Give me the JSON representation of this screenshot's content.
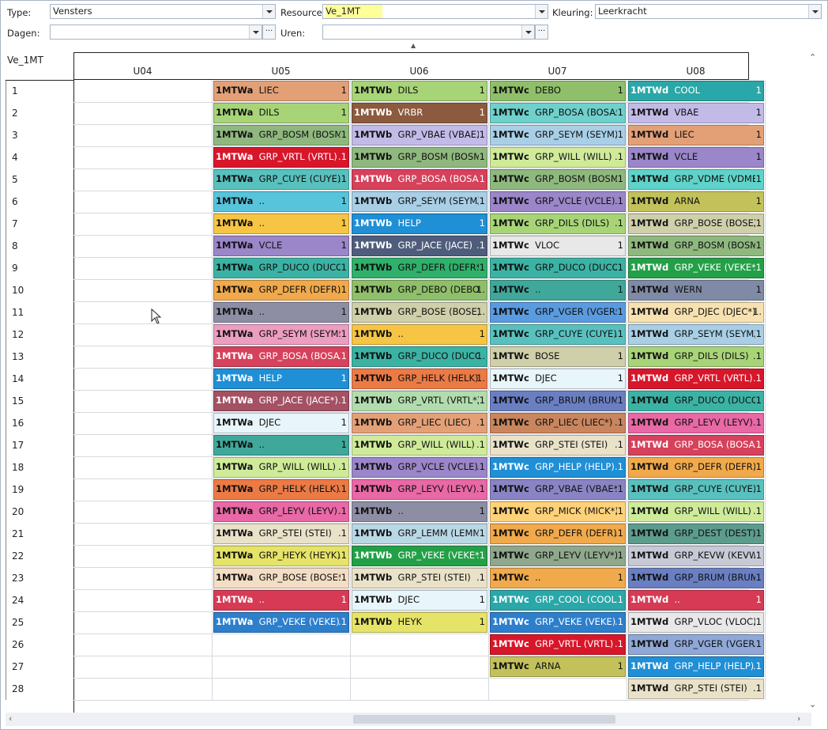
{
  "toolbar": {
    "type_label": "Type:",
    "type_value": "Vensters",
    "resource_label": "Resource:",
    "resource_value": "Ve_1MT",
    "kleuring_label": "Kleuring:",
    "kleuring_value": "Leerkracht",
    "dagen_label": "Dagen:",
    "dagen_value": "",
    "uren_label": "Uren:",
    "uren_value": "",
    "more_label": "···"
  },
  "grid": {
    "resource_title": "Ve_1MT",
    "columns": [
      "U04",
      "U05",
      "U06",
      "U07",
      "U08"
    ],
    "rows": [
      "1",
      "2",
      "3",
      "4",
      "5",
      "6",
      "7",
      "8",
      "9",
      "10",
      "11",
      "12",
      "13",
      "14",
      "15",
      "16",
      "17",
      "18",
      "19",
      "20",
      "21",
      "22",
      "23",
      "24",
      "25",
      "26",
      "27",
      "28"
    ],
    "cells": [
      [
        {
          "c": "1MTWa",
          "t": "LIEC",
          "n": "1",
          "bg": "#e3a077",
          "fg": "#111"
        },
        {
          "c": "1MTWa",
          "t": "DILS",
          "n": "1",
          "bg": "#a8d478",
          "fg": "#111"
        },
        {
          "c": "1MTWa",
          "t": "GRP_BOSM (BOSM)",
          "n": ".1",
          "bg": "#8fb87e",
          "fg": "#111"
        },
        {
          "c": "1MTWa",
          "t": "GRP_VRTL (VRTL)",
          "n": ".1",
          "bg": "#d8162a",
          "fg": "#fff"
        },
        {
          "c": "1MTWa",
          "t": "GRP_CUYE (CUYE)",
          "n": ".1",
          "bg": "#58c1be",
          "fg": "#111"
        },
        {
          "c": "1MTWa",
          "t": "..",
          "n": "1",
          "bg": "#57c4dc",
          "fg": "#111"
        },
        {
          "c": "1MTWa",
          "t": "..",
          "n": "1",
          "bg": "#f7c544",
          "fg": "#111"
        },
        {
          "c": "1MTWa",
          "t": "VCLE",
          "n": "1",
          "bg": "#9a86c8",
          "fg": "#111"
        },
        {
          "c": "1MTWa",
          "t": "GRP_DUCO (DUCO)",
          "n": ".1",
          "bg": "#3bb3a4",
          "fg": "#111"
        },
        {
          "c": "1MTWa",
          "t": "GRP_DEFR (DEFR)",
          "n": ".1",
          "bg": "#f0a94b",
          "fg": "#111"
        },
        {
          "c": "1MTWa",
          "t": "..",
          "n": "1",
          "bg": "#8d8ea4",
          "fg": "#111"
        },
        {
          "c": "1MTWa",
          "t": "GRP_SEYM (SEYM*)",
          "n": ".1",
          "bg": "#ec9dc0",
          "fg": "#111"
        },
        {
          "c": "1MTWa",
          "t": "GRP_BOSA (BOSA)",
          "n": ".1",
          "bg": "#d6415b",
          "fg": "#fff"
        },
        {
          "c": "1MTWa",
          "t": "HELP",
          "n": "1",
          "bg": "#1f8fd6",
          "fg": "#fff"
        },
        {
          "c": "1MTWa",
          "t": "GRP_JACE (JACE*)",
          "n": ".1",
          "bg": "#a35163",
          "fg": "#fff"
        },
        {
          "c": "1MTWa",
          "t": "DJEC",
          "n": "1",
          "bg": "#e8f6fb",
          "fg": "#111"
        },
        {
          "c": "1MTWa",
          "t": "..",
          "n": "1",
          "bg": "#3fa89b",
          "fg": "#111"
        },
        {
          "c": "1MTWa",
          "t": "GRP_WILL (WILL)",
          "n": ".1",
          "bg": "#cfeb9a",
          "fg": "#111"
        },
        {
          "c": "1MTWa",
          "t": "GRP_HELK (HELK)",
          "n": ".1",
          "bg": "#ec7a45",
          "fg": "#111"
        },
        {
          "c": "1MTWa",
          "t": "GRP_LEYV (LEYV)",
          "n": ".1",
          "bg": "#e968a6",
          "fg": "#111"
        },
        {
          "c": "1MTWa",
          "t": "GRP_STEI (STEI)",
          "n": ".1",
          "bg": "#e9e2c9",
          "fg": "#111"
        },
        {
          "c": "1MTWa",
          "t": "GRP_HEYK (HEYK)",
          "n": ".1",
          "bg": "#e6e468",
          "fg": "#111"
        },
        {
          "c": "1MTWa",
          "t": "GRP_BOSE (BOSE*)",
          "n": ".1",
          "bg": "#f3ddc4",
          "fg": "#111"
        },
        {
          "c": "1MTWa",
          "t": "..",
          "n": "1",
          "bg": "#d63a54",
          "fg": "#fff"
        },
        {
          "c": "1MTWa",
          "t": "GRP_VEKE (VEKE)",
          "n": ".1",
          "bg": "#2d7fcc",
          "fg": "#fff"
        },
        null,
        null,
        null
      ],
      [
        {
          "c": "1MTWb",
          "t": "DILS",
          "n": "1",
          "bg": "#a8d478",
          "fg": "#111"
        },
        {
          "c": "1MTWb",
          "t": "VRBR",
          "n": "1",
          "bg": "#8c5a3e",
          "fg": "#fff"
        },
        {
          "c": "1MTWb",
          "t": "GRP_VBAE (VBAE)",
          "n": ".1",
          "bg": "#c2bbe8",
          "fg": "#111"
        },
        {
          "c": "1MTWb",
          "t": "GRP_BOSM (BOSM)",
          "n": ".1",
          "bg": "#8fb87e",
          "fg": "#111"
        },
        {
          "c": "1MTWb",
          "t": "GRP_BOSA (BOSA)",
          "n": ".1",
          "bg": "#d6415b",
          "fg": "#fff"
        },
        {
          "c": "1MTWb",
          "t": "GRP_SEYM (SEYM)",
          "n": ".1",
          "bg": "#a8cfe6",
          "fg": "#111"
        },
        {
          "c": "1MTWb",
          "t": "HELP",
          "n": "1",
          "bg": "#1f8fd6",
          "fg": "#fff"
        },
        {
          "c": "1MTWb",
          "t": "GRP_JACE (JACE)",
          "n": ".1",
          "bg": "#4f5d7c",
          "fg": "#fff"
        },
        {
          "c": "1MTWb",
          "t": "GRP_DEFR (DEFR*)",
          "n": ".1",
          "bg": "#2fb06b",
          "fg": "#111"
        },
        {
          "c": "1MTWb",
          "t": "GRP_DEBO (DEBO)",
          "n": "1.",
          "bg": "#8fbf6a",
          "fg": "#111"
        },
        {
          "c": "1MTWb",
          "t": "GRP_BOSE (BOSE)",
          "n": "1.",
          "bg": "#cfcfaa",
          "fg": "#111"
        },
        {
          "c": "1MTWb",
          "t": "..",
          "n": "1",
          "bg": "#f7c544",
          "fg": "#111"
        },
        {
          "c": "1MTWb",
          "t": "GRP_DUCO (DUCO)",
          "n": "1.",
          "bg": "#3bb3a4",
          "fg": "#111"
        },
        {
          "c": "1MTWb",
          "t": "GRP_HELK (HELK)",
          "n": "1.",
          "bg": "#ec7a45",
          "fg": "#111"
        },
        {
          "c": "1MTWb",
          "t": "GRP_VRTL (VRTL*)",
          "n": ".1",
          "bg": "#b2dcae",
          "fg": "#111"
        },
        {
          "c": "1MTWb",
          "t": "GRP_LIEC (LIEC)",
          "n": ".1",
          "bg": "#e3a077",
          "fg": "#111"
        },
        {
          "c": "1MTWb",
          "t": "GRP_WILL (WILL)",
          "n": ".1",
          "bg": "#cfeb9a",
          "fg": "#111"
        },
        {
          "c": "1MTWb",
          "t": "GRP_VCLE (VCLE)",
          "n": ".1",
          "bg": "#9a86c8",
          "fg": "#111"
        },
        {
          "c": "1MTWb",
          "t": "GRP_LEYV (LEYV)",
          "n": ".1",
          "bg": "#e968a6",
          "fg": "#111"
        },
        {
          "c": "1MTWb",
          "t": "..",
          "n": "1",
          "bg": "#8d8ea4",
          "fg": "#111"
        },
        {
          "c": "1MTWb",
          "t": "GRP_LEMM (LEMM)",
          "n": ".1",
          "bg": "#b9d8e6",
          "fg": "#111"
        },
        {
          "c": "1MTWb",
          "t": "GRP_VEKE (VEKE*)",
          "n": ".1",
          "bg": "#23a047",
          "fg": "#fff"
        },
        {
          "c": "1MTWb",
          "t": "GRP_STEI (STEI)",
          "n": ".1",
          "bg": "#e9e2c9",
          "fg": "#111"
        },
        {
          "c": "1MTWb",
          "t": "DJEC",
          "n": "1",
          "bg": "#e8f6fb",
          "fg": "#111"
        },
        {
          "c": "1MTWb",
          "t": "HEYK",
          "n": "1",
          "bg": "#e6e468",
          "fg": "#111"
        },
        null,
        null,
        null
      ],
      [
        {
          "c": "1MTWc",
          "t": "DEBO",
          "n": "1",
          "bg": "#8fbf6a",
          "fg": "#111"
        },
        {
          "c": "1MTWc",
          "t": "GRP_BOSA (BOSA*)",
          "n": ".1",
          "bg": "#6fd0cc",
          "fg": "#111"
        },
        {
          "c": "1MTWc",
          "t": "GRP_SEYM (SEYM)",
          "n": ".1",
          "bg": "#a8cfe6",
          "fg": "#111"
        },
        {
          "c": "1MTWc",
          "t": "GRP_WILL (WILL)",
          "n": ".1",
          "bg": "#cfeb9a",
          "fg": "#111"
        },
        {
          "c": "1MTWc",
          "t": "GRP_BOSM (BOSM)",
          "n": ".1",
          "bg": "#8fb87e",
          "fg": "#111"
        },
        {
          "c": "1MTWc",
          "t": "GRP_VCLE (VCLE)",
          "n": ".1",
          "bg": "#9a86c8",
          "fg": "#111"
        },
        {
          "c": "1MTWc",
          "t": "GRP_DILS (DILS)",
          "n": ".1",
          "bg": "#a8d478",
          "fg": "#111"
        },
        {
          "c": "1MTWc",
          "t": "VLOC",
          "n": "1",
          "bg": "#e8e8e8",
          "fg": "#111"
        },
        {
          "c": "1MTWc",
          "t": "GRP_DUCO (DUCO)",
          "n": ".1",
          "bg": "#3bb3a4",
          "fg": "#111"
        },
        {
          "c": "1MTWc",
          "t": "..",
          "n": "1",
          "bg": "#3fa89b",
          "fg": "#111"
        },
        {
          "c": "1MTWc",
          "t": "GRP_VGER (VGER*)",
          "n": ".1",
          "bg": "#5a9be0",
          "fg": "#111"
        },
        {
          "c": "1MTWc",
          "t": "GRP_CUYE (CUYE)",
          "n": ".1",
          "bg": "#58c1be",
          "fg": "#111"
        },
        {
          "c": "1MTWc",
          "t": "BOSE",
          "n": "1",
          "bg": "#cfcfaa",
          "fg": "#111"
        },
        {
          "c": "1MTWc",
          "t": "DJEC",
          "n": "1",
          "bg": "#e8f6fb",
          "fg": "#111"
        },
        {
          "c": "1MTWc",
          "t": "GRP_BRUM (BRUM)",
          "n": ".1",
          "bg": "#6a7fc2",
          "fg": "#111"
        },
        {
          "c": "1MTWc",
          "t": "GRP_LIEC (LIEC*)",
          "n": ".1",
          "bg": "#c9855e",
          "fg": "#111"
        },
        {
          "c": "1MTWc",
          "t": "GRP_STEI (STEI)",
          "n": ".1",
          "bg": "#e9e2c9",
          "fg": "#111"
        },
        {
          "c": "1MTWc",
          "t": "GRP_HELP (HELP)",
          "n": ".1",
          "bg": "#1f8fd6",
          "fg": "#fff"
        },
        {
          "c": "1MTWc",
          "t": "GRP_VBAE (VBAE*)",
          "n": ".1",
          "bg": "#8a84c4",
          "fg": "#111"
        },
        {
          "c": "1MTWc",
          "t": "GRP_MICK (MICK*)",
          "n": ".1",
          "bg": "#ffd27a",
          "fg": "#111"
        },
        {
          "c": "1MTWc",
          "t": "GRP_DEFR (DEFR)",
          "n": ".1",
          "bg": "#f0a94b",
          "fg": "#111"
        },
        {
          "c": "1MTWc",
          "t": "GRP_LEYV (LEYV*)",
          "n": ".1",
          "bg": "#8fa88c",
          "fg": "#111"
        },
        {
          "c": "1MTWc",
          "t": "..",
          "n": "1",
          "bg": "#f0a94b",
          "fg": "#111"
        },
        {
          "c": "1MTWc",
          "t": "GRP_COOL (COOL)",
          "n": ".1",
          "bg": "#2aa7a8",
          "fg": "#fff"
        },
        {
          "c": "1MTWc",
          "t": "GRP_VEKE (VEKE)",
          "n": ".1",
          "bg": "#2d7fcc",
          "fg": "#fff"
        },
        {
          "c": "1MTWc",
          "t": "GRP_VRTL (VRTL)",
          "n": ".1",
          "bg": "#d8162a",
          "fg": "#fff"
        },
        {
          "c": "1MTWc",
          "t": "ARNA",
          "n": "1",
          "bg": "#c3c25a",
          "fg": "#111"
        },
        null
      ],
      [
        {
          "c": "1MTWd",
          "t": "COOL",
          "n": "1",
          "bg": "#2aa7a8",
          "fg": "#fff"
        },
        {
          "c": "1MTWd",
          "t": "VBAE",
          "n": "1",
          "bg": "#c2bbe8",
          "fg": "#111"
        },
        {
          "c": "1MTWd",
          "t": "LIEC",
          "n": "1",
          "bg": "#e3a077",
          "fg": "#111"
        },
        {
          "c": "1MTWd",
          "t": "VCLE",
          "n": "1",
          "bg": "#9a86c8",
          "fg": "#111"
        },
        {
          "c": "1MTWd",
          "t": "GRP_VDME (VDME)",
          "n": ".1",
          "bg": "#5fd3c9",
          "fg": "#111"
        },
        {
          "c": "1MTWd",
          "t": "ARNA",
          "n": "1",
          "bg": "#c3c25a",
          "fg": "#111"
        },
        {
          "c": "1MTWd",
          "t": "GRP_BOSE (BOSE)",
          "n": ".1",
          "bg": "#cfcfaa",
          "fg": "#111"
        },
        {
          "c": "1MTWd",
          "t": "GRP_BOSM (BOSM)",
          "n": ".1",
          "bg": "#8fb87e",
          "fg": "#111"
        },
        {
          "c": "1MTWd",
          "t": "GRP_VEKE (VEKE*)",
          "n": ".1",
          "bg": "#23a047",
          "fg": "#fff"
        },
        {
          "c": "1MTWd",
          "t": "WERN",
          "n": "1",
          "bg": "#7f8aa6",
          "fg": "#111"
        },
        {
          "c": "1MTWd",
          "t": "GRP_DJEC (DJEC*)",
          "n": "1.",
          "bg": "#f7e1b0",
          "fg": "#111"
        },
        {
          "c": "1MTWd",
          "t": "GRP_SEYM (SEYM)",
          "n": ".1",
          "bg": "#a8cfe6",
          "fg": "#111"
        },
        {
          "c": "1MTWd",
          "t": "GRP_DILS (DILS)",
          "n": ".1",
          "bg": "#a8d478",
          "fg": "#111"
        },
        {
          "c": "1MTWd",
          "t": "GRP_VRTL (VRTL)",
          "n": ".1",
          "bg": "#d8162a",
          "fg": "#fff"
        },
        {
          "c": "1MTWd",
          "t": "GRP_DUCO (DUCO)",
          "n": ".1",
          "bg": "#3bb3a4",
          "fg": "#111"
        },
        {
          "c": "1MTWd",
          "t": "GRP_LEYV (LEYV)",
          "n": ".1",
          "bg": "#e968a6",
          "fg": "#111"
        },
        {
          "c": "1MTWd",
          "t": "GRP_BOSA (BOSA)",
          "n": ".1",
          "bg": "#d6415b",
          "fg": "#fff"
        },
        {
          "c": "1MTWd",
          "t": "GRP_DEFR (DEFR)",
          "n": ".1",
          "bg": "#f0a94b",
          "fg": "#111"
        },
        {
          "c": "1MTWd",
          "t": "GRP_CUYE (CUYE)",
          "n": ".1",
          "bg": "#58c1be",
          "fg": "#111"
        },
        {
          "c": "1MTWd",
          "t": "GRP_WILL (WILL)",
          "n": ".1",
          "bg": "#cfeb9a",
          "fg": "#111"
        },
        {
          "c": "1MTWd",
          "t": "GRP_DEST (DEST)",
          "n": ".1",
          "bg": "#5c9c8c",
          "fg": "#111"
        },
        {
          "c": "1MTWd",
          "t": "GRP_KEVW (KEVW)",
          "n": ".1",
          "bg": "#c7cad6",
          "fg": "#111"
        },
        {
          "c": "1MTWd",
          "t": "GRP_BRUM (BRUM)",
          "n": ".1",
          "bg": "#6a7fc2",
          "fg": "#111"
        },
        {
          "c": "1MTWd",
          "t": "..",
          "n": "1",
          "bg": "#d63a54",
          "fg": "#fff"
        },
        {
          "c": "1MTWd",
          "t": "GRP_VLOC (VLOC)",
          "n": ".1",
          "bg": "#e8e8e8",
          "fg": "#111"
        },
        {
          "c": "1MTWd",
          "t": "GRP_VGER (VGER)",
          "n": ".1",
          "bg": "#8fa8d8",
          "fg": "#111"
        },
        {
          "c": "1MTWd",
          "t": "GRP_HELP (HELP)",
          "n": ".1",
          "bg": "#1f8fd6",
          "fg": "#fff"
        },
        {
          "c": "1MTWd",
          "t": "GRP_STEI (STEI)",
          "n": ".1",
          "bg": "#e9e2c9",
          "fg": "#111"
        }
      ]
    ]
  }
}
